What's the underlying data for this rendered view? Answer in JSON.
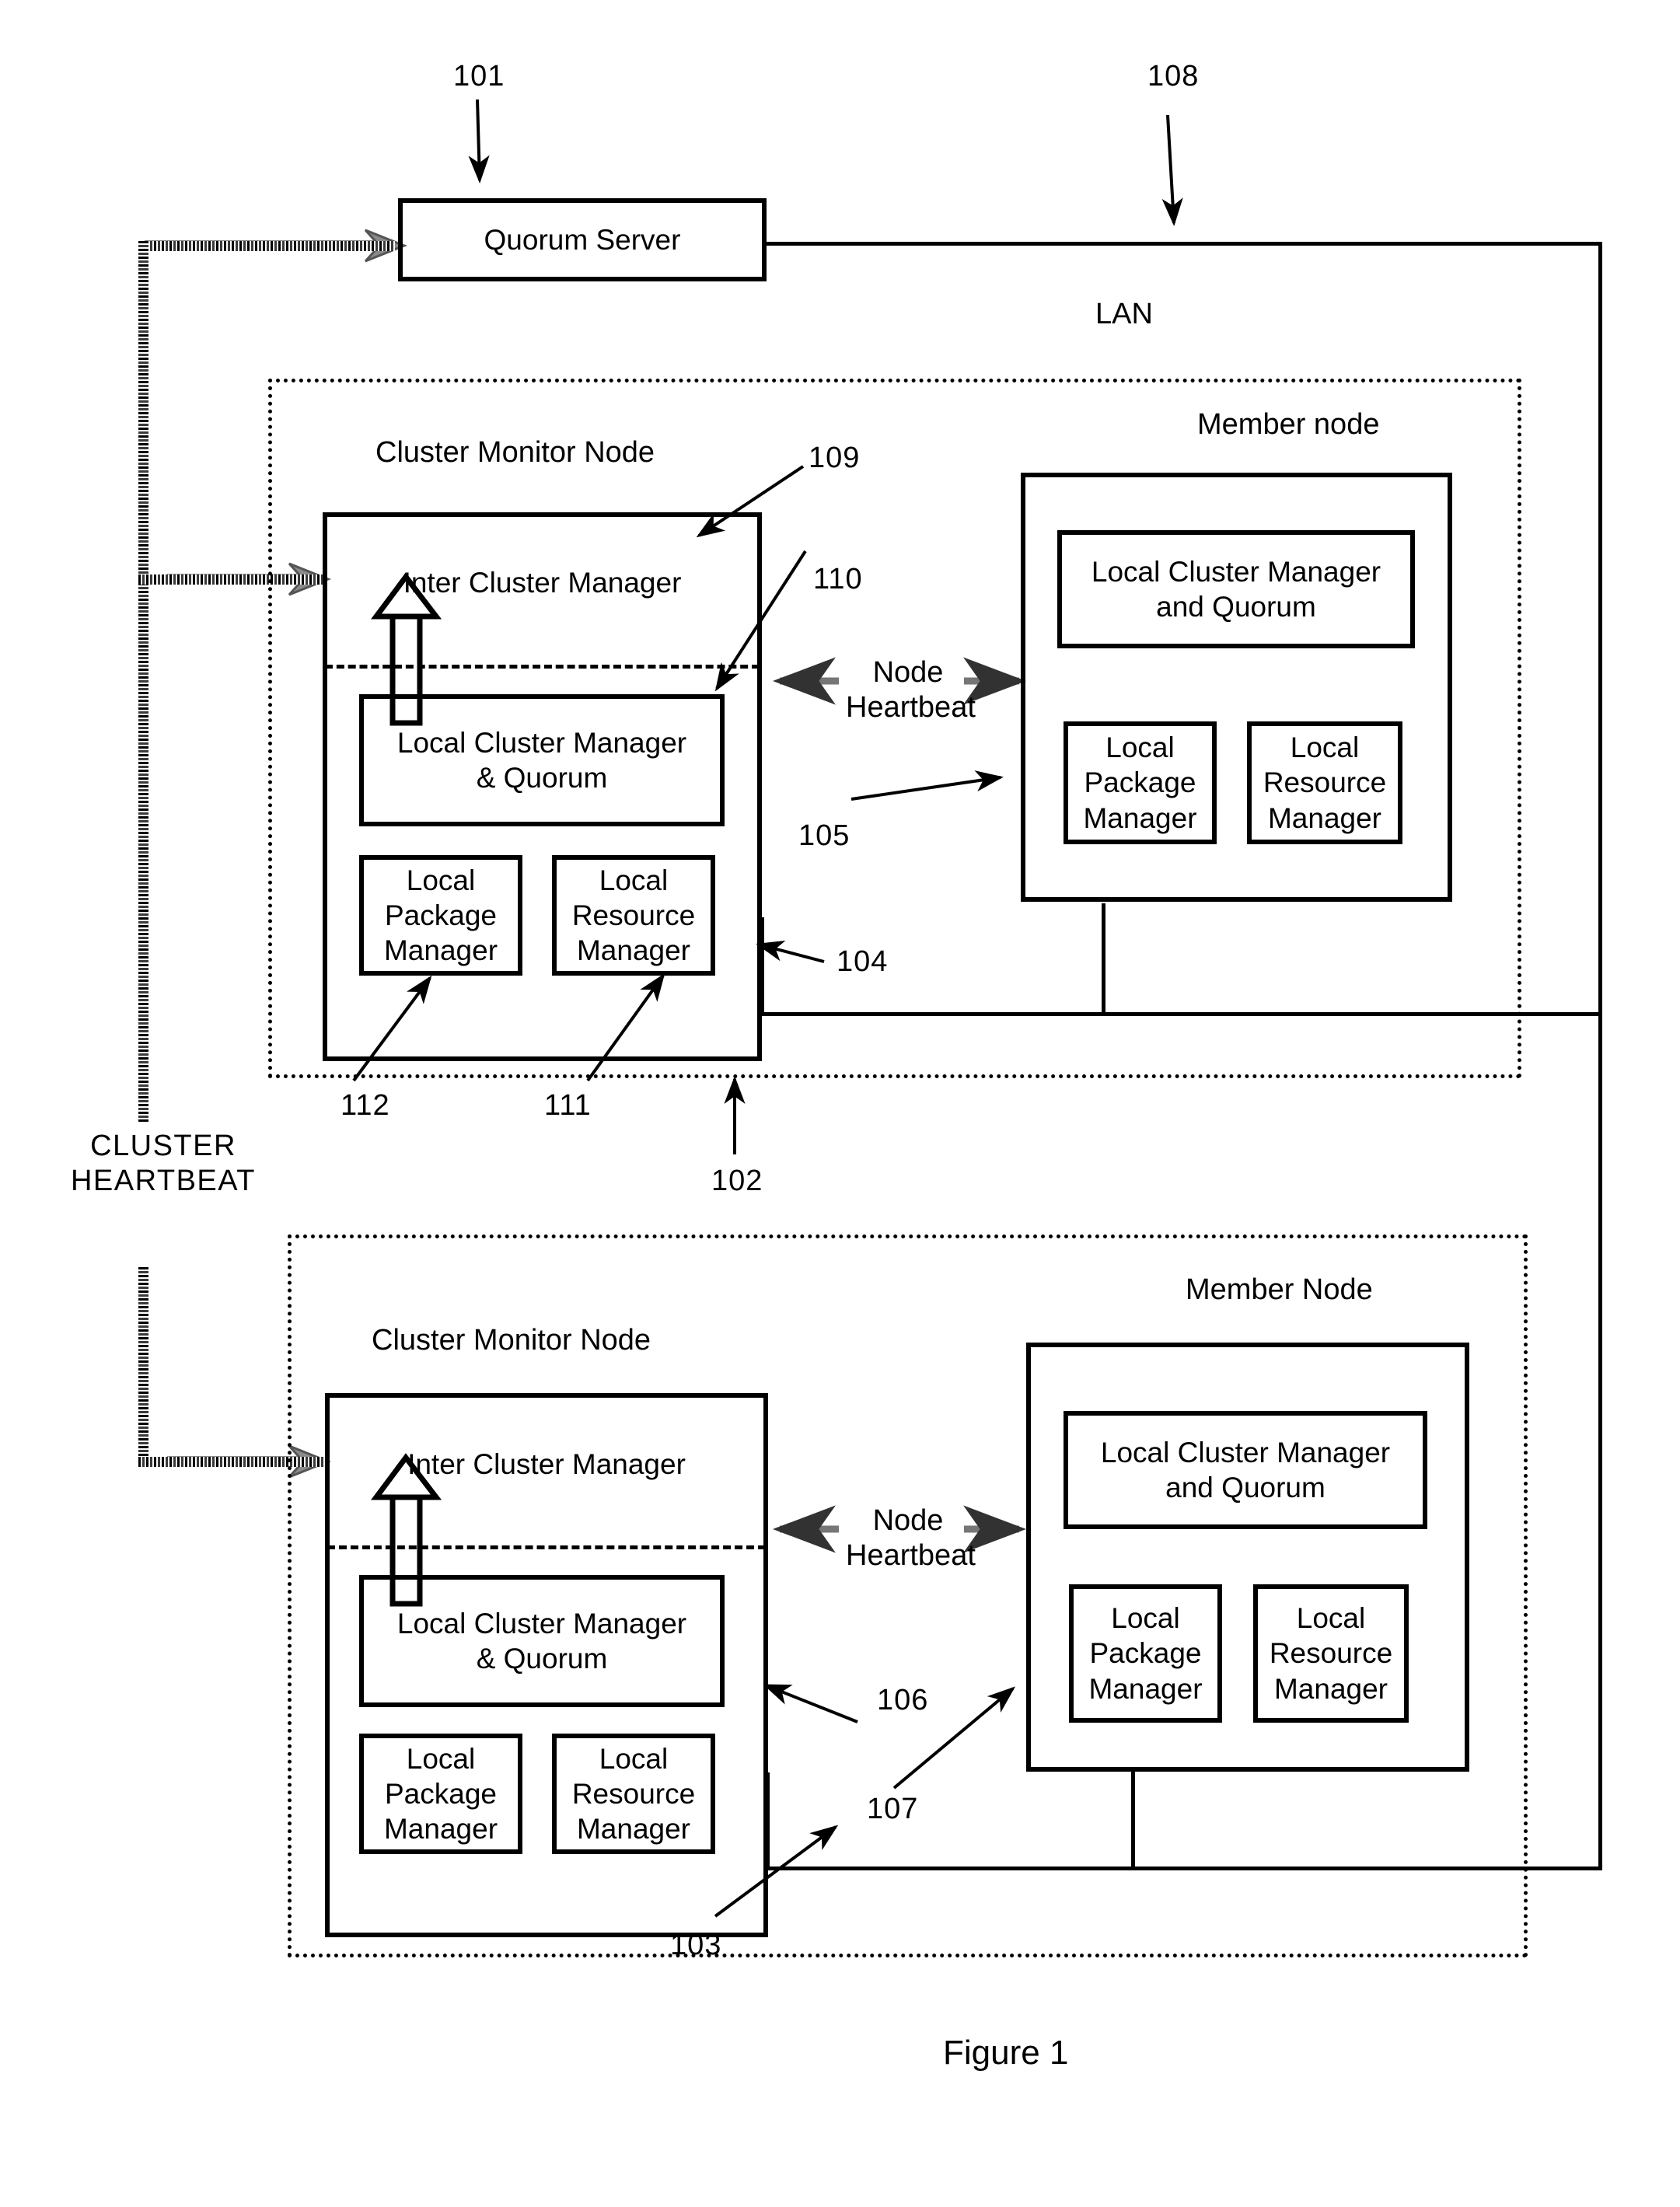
{
  "figure": {
    "caption": "Figure 1"
  },
  "network": {
    "lan_label": "LAN",
    "lan_ref": "108",
    "cluster_heartbeat_label": "CLUSTER\nHEARTBEAT"
  },
  "quorum_server": {
    "label": "Quorum Server",
    "ref": "101"
  },
  "clusters": [
    {
      "ref": "102",
      "monitor_node": {
        "title": "Cluster Monitor Node",
        "ref": "104",
        "inter_cluster_manager": {
          "label": "Inter Cluster Manager",
          "ref": "109"
        },
        "local_cluster_manager": {
          "label": "Local Cluster Manager\n& Quorum",
          "ref": "110"
        },
        "local_package_manager": {
          "label": "Local\nPackage\nManager",
          "ref": "112"
        },
        "local_resource_manager": {
          "label": "Local\nResource\nManager",
          "ref": "111"
        }
      },
      "member_node": {
        "title": "Member node",
        "ref": "105",
        "local_cluster_manager": {
          "label": "Local Cluster Manager\nand Quorum"
        },
        "local_package_manager": {
          "label": "Local\nPackage\nManager"
        },
        "local_resource_manager": {
          "label": "Local\nResource\nManager"
        }
      },
      "node_heartbeat_label": "Node\nHeartbeat"
    },
    {
      "ref": "103",
      "monitor_node": {
        "title": "Cluster Monitor Node",
        "ref": "106",
        "inter_cluster_manager": {
          "label": "Inter Cluster Manager"
        },
        "local_cluster_manager": {
          "label": "Local Cluster Manager\n& Quorum"
        },
        "local_package_manager": {
          "label": "Local\nPackage\nManager"
        },
        "local_resource_manager": {
          "label": "Local\nResource\nManager"
        }
      },
      "member_node": {
        "title": "Member Node",
        "ref": "107",
        "local_cluster_manager": {
          "label": "Local Cluster Manager\nand Quorum"
        },
        "local_package_manager": {
          "label": "Local\nPackage\nManager"
        },
        "local_resource_manager": {
          "label": "Local\nResource\nManager"
        }
      },
      "node_heartbeat_label": "Node\nHeartbeat"
    }
  ],
  "colors": {
    "ink": "#000000",
    "paper": "#ffffff"
  }
}
